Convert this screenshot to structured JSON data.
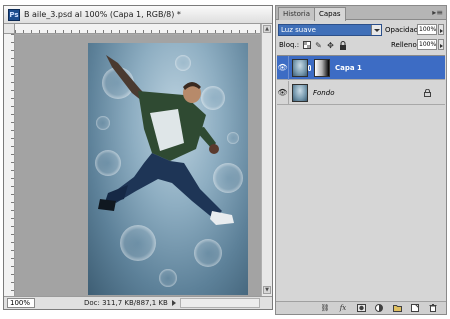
{
  "document": {
    "app_icon_text": "Ps",
    "title": "B aile_3.psd al 100% (Capa 1, RGB/8) *",
    "zoom": "100%",
    "doc_info": "Doc: 311,7 KB/887,1 KB"
  },
  "panel": {
    "tabs": [
      {
        "label": "Historia",
        "active": false
      },
      {
        "label": "Capas",
        "active": true
      }
    ],
    "menu_icon": "panel-menu-icon",
    "blend_mode": "Luz suave",
    "opacity_label": "Opacidad:",
    "opacity_value": "100%",
    "lock_label": "Bloq.:",
    "lock_icons": [
      "lock-transparent-icon",
      "lock-brush-icon",
      "lock-move-icon",
      "lock-all-icon"
    ],
    "fill_label": "Relleno:",
    "fill_value": "100%",
    "layers": [
      {
        "name": "Capa 1",
        "visible": true,
        "selected": true,
        "has_mask": true
      },
      {
        "name": "Fondo",
        "visible": true,
        "selected": false,
        "locked": true
      }
    ],
    "footer_icons": [
      "link-layers-icon",
      "fx-icon",
      "add-mask-icon",
      "adjustment-layer-icon",
      "new-group-icon",
      "new-layer-icon",
      "delete-layer-icon"
    ]
  },
  "colors": {
    "selection": "#3d6cc4",
    "blend_select": "#3f6fb8",
    "canvas_bg": "#a3a3a3"
  }
}
